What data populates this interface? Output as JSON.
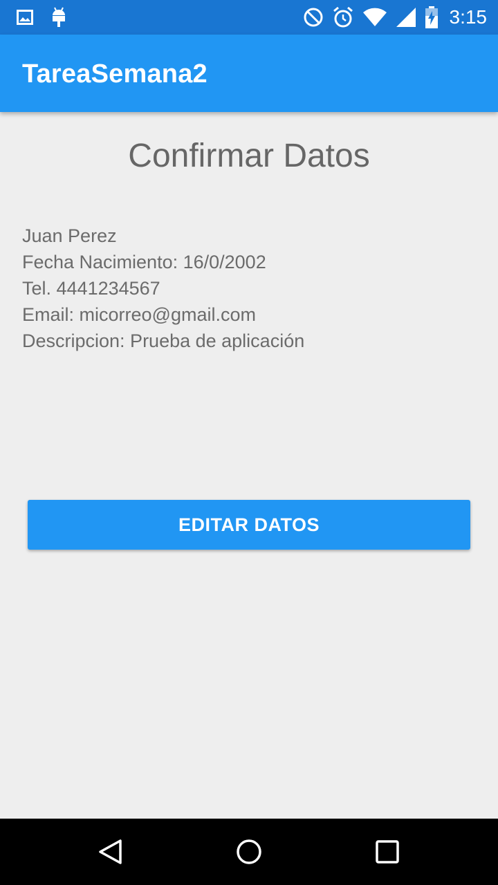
{
  "status_bar": {
    "time": "3:15",
    "icons": [
      "image-icon",
      "android-icon",
      "do-not-disturb-icon",
      "alarm-icon",
      "wifi-icon",
      "signal-icon",
      "battery-charging-icon"
    ]
  },
  "app_bar": {
    "title": "TareaSemana2"
  },
  "main": {
    "title": "Confirmar Datos",
    "details": {
      "name": "Juan Perez",
      "birth_date": "Fecha Nacimiento: 16/0/2002",
      "phone": "Tel. 4441234567",
      "email": "Email: micorreo@gmail.com",
      "description": "Descripcion: Prueba de aplicación"
    },
    "edit_button_label": "EDITAR DATOS"
  },
  "nav_bar": {
    "icons": [
      "back-icon",
      "home-icon",
      "recent-apps-icon"
    ]
  },
  "colors": {
    "status_bar": "#1976d2",
    "app_bar": "#2196f3",
    "background": "#eeeeee",
    "text": "#6b6b6b"
  }
}
